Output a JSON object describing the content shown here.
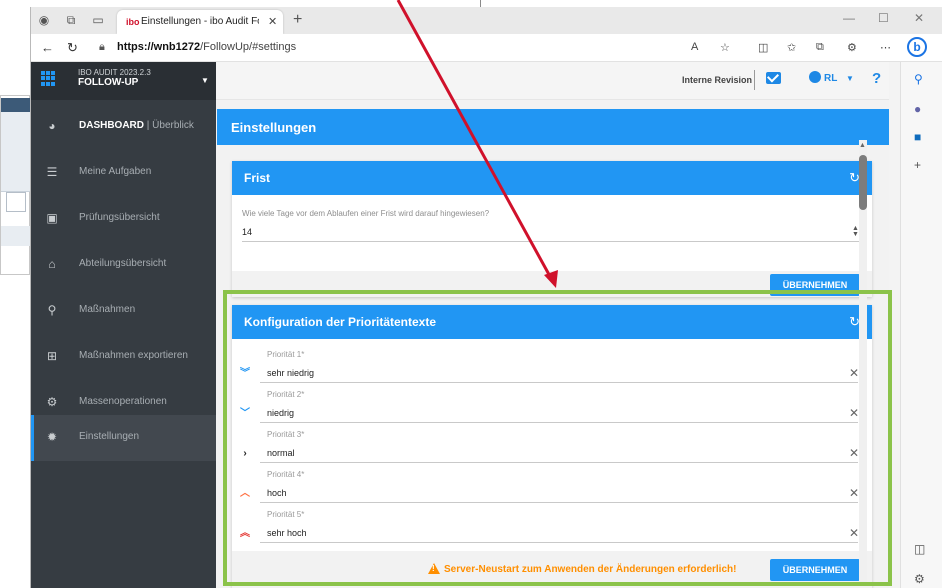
{
  "browser": {
    "tab_title": "Einstellungen - ibo Audit Followu",
    "tab_favicon": "ibo",
    "url_host": "https://wnb1272",
    "url_path": "/FollowUp/#settings"
  },
  "app": {
    "version": "IBO AUDIT 2023.2.3",
    "name": "FOLLOW-UP"
  },
  "topbar": {
    "department": "Interne Revision",
    "user": "RL",
    "help": "?"
  },
  "sidebar": {
    "items": [
      {
        "bold": "DASHBOARD",
        "rest": " | Überblick",
        "icon": "pie-chart-icon"
      },
      {
        "label": "Meine Aufgaben",
        "icon": "task-list-icon"
      },
      {
        "label": "Prüfungsübersicht",
        "icon": "clipboard-icon"
      },
      {
        "label": "Abteilungsübersicht",
        "icon": "home-icon"
      },
      {
        "label": "Maßnahmen",
        "icon": "search-icon"
      },
      {
        "label": "Maßnahmen exportieren",
        "icon": "table-export-icon"
      },
      {
        "label": "Massenoperationen",
        "icon": "cogs-icon"
      },
      {
        "label": "Einstellungen",
        "icon": "gear-icon"
      }
    ]
  },
  "page": {
    "title": "Einstellungen"
  },
  "frist": {
    "title": "Frist",
    "field_label": "Wie viele Tage vor dem Ablaufen einer Frist wird darauf hingewiesen?",
    "field_value": "14",
    "apply_label": "ÜBERNEHMEN"
  },
  "prio": {
    "title": "Konfiguration der Prioritätentexte",
    "rows": [
      {
        "label": "Priorität 1*",
        "value": "sehr niedrig",
        "icon": "double-chevron-down-icon",
        "color": "#2196f3"
      },
      {
        "label": "Priorität 2*",
        "value": "niedrig",
        "icon": "chevron-down-icon",
        "color": "#2196f3"
      },
      {
        "label": "Priorität 3*",
        "value": "normal",
        "icon": "chevron-right-icon",
        "color": "#222222"
      },
      {
        "label": "Priorität 4*",
        "value": "hoch",
        "icon": "chevron-up-icon",
        "color": "#ff7043"
      },
      {
        "label": "Priorität 5*",
        "value": "sehr hoch",
        "icon": "double-chevron-up-icon",
        "color": "#e53935"
      }
    ],
    "warning": "Server-Neustart zum Anwenden der Änderungen erforderlich!",
    "apply_label": "ÜBERNEHMEN"
  },
  "colors": {
    "accent": "#2196f3",
    "sidebar": "#363c42",
    "highlight": "#8bc34a",
    "annotation_arrow": "#d0112b",
    "warning": "#ff8f00"
  }
}
